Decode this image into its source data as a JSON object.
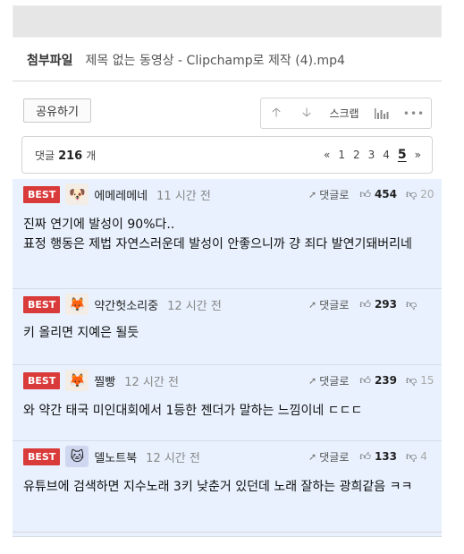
{
  "attachment": {
    "label": "첨부파일",
    "filename": "제목 없는 동영상 - Clipchamp로 제작 (4).mp4"
  },
  "share_label": "공유하기",
  "actions": {
    "up_icon": "arrow-up-icon",
    "down_icon": "arrow-down-icon",
    "scrap_label": "스크랩",
    "chart_icon": "bar-chart-icon",
    "more_icon": "more-dots-icon"
  },
  "comment_count": {
    "prefix": "댓글",
    "count": "216",
    "suffix": "개"
  },
  "pagination": {
    "prev": "«",
    "pages": [
      "1",
      "2",
      "3",
      "4"
    ],
    "current": "5",
    "next": "»"
  },
  "comments": [
    {
      "badge": "BEST",
      "nickname": "에메레메네",
      "time": "11 시간 전",
      "reply": "댓글로",
      "likes": "454",
      "dislikes": "20",
      "text": "진짜 연기에 발성이 90%다..\n표정 행동은 제법 자연스러운데 발성이 안좋으니까 걍 죄다 발연기돼버리네"
    },
    {
      "badge": "BEST",
      "nickname": "약간헛소리중",
      "time": "12 시간 전",
      "reply": "댓글로",
      "likes": "293",
      "dislikes": "",
      "text": "키 올리면 지예은 될듯"
    },
    {
      "badge": "BEST",
      "nickname": "찔빵",
      "time": "12 시간 전",
      "reply": "댓글로",
      "likes": "239",
      "dislikes": "15",
      "text": "와 약간 태국 미인대회에서 1등한 젠더가 말하는 느낌이네 ㄷㄷㄷ"
    },
    {
      "badge": "BEST",
      "nickname": "델노트북",
      "time": "12 시간 전",
      "reply": "댓글로",
      "likes": "133",
      "dislikes": "4",
      "text": "유튜브에 검색하면 지수노래 3키 낮춘거 있던데 노래 잘하는 광희같음 ㅋㅋ"
    }
  ]
}
